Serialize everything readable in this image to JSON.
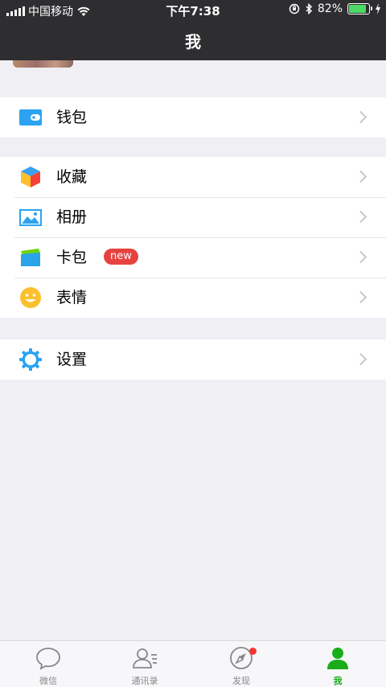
{
  "status_bar": {
    "carrier": "中国移动",
    "time": "下午7:38",
    "battery_percent": "82%",
    "battery_level": 0.82
  },
  "header": {
    "title": "我"
  },
  "menu": {
    "wallet": {
      "label": "钱包",
      "icon": "wallet-icon"
    },
    "favorites": {
      "label": "收藏",
      "icon": "cube-icon"
    },
    "album": {
      "label": "相册",
      "icon": "picture-icon"
    },
    "cards": {
      "label": "卡包",
      "icon": "card-icon",
      "badge": "new"
    },
    "stickers": {
      "label": "表情",
      "icon": "smiley-icon"
    },
    "settings": {
      "label": "设置",
      "icon": "gear-icon"
    }
  },
  "tabbar": {
    "tabs": [
      {
        "label": "微信",
        "icon": "chat-bubble-icon"
      },
      {
        "label": "通讯录",
        "icon": "contacts-icon"
      },
      {
        "label": "发现",
        "icon": "compass-icon",
        "dot": true
      },
      {
        "label": "我",
        "icon": "profile-icon",
        "active": true
      }
    ]
  },
  "colors": {
    "accent": "#1aad19",
    "badge_red": "#e64340",
    "header_bg": "#2e2e31",
    "page_bg": "#efeff4"
  }
}
